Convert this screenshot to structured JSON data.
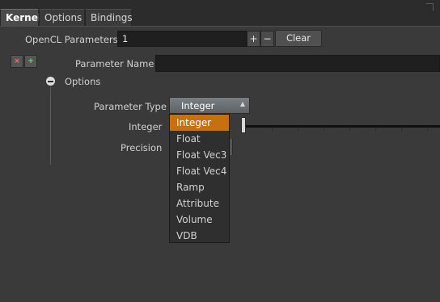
{
  "tabs": [
    {
      "label": "Kernel",
      "active": true
    },
    {
      "label": "Options",
      "active": false
    },
    {
      "label": "Bindings",
      "active": false
    }
  ],
  "opencl": {
    "label": "OpenCL Parameters",
    "value": "1",
    "increment_label": "+",
    "decrement_label": "−",
    "clear_label": "Clear"
  },
  "param_buttons": {
    "remove_glyph": "×",
    "insert_glyph": "+"
  },
  "parameter_name": {
    "label": "Parameter Name",
    "value": ""
  },
  "options_folder": {
    "label": "Options"
  },
  "parameter_type": {
    "label": "Parameter Type",
    "selected": "Integer",
    "options": [
      "Integer",
      "Float",
      "Float Vec3",
      "Float Vec4",
      "Ramp",
      "Attribute",
      "Volume",
      "VDB"
    ]
  },
  "integer": {
    "label": "Integer"
  },
  "precision": {
    "label": "Precision"
  },
  "colors": {
    "background": "#3a3a3a",
    "highlight": "#c6700f",
    "input_bg": "#1f1f1f"
  }
}
